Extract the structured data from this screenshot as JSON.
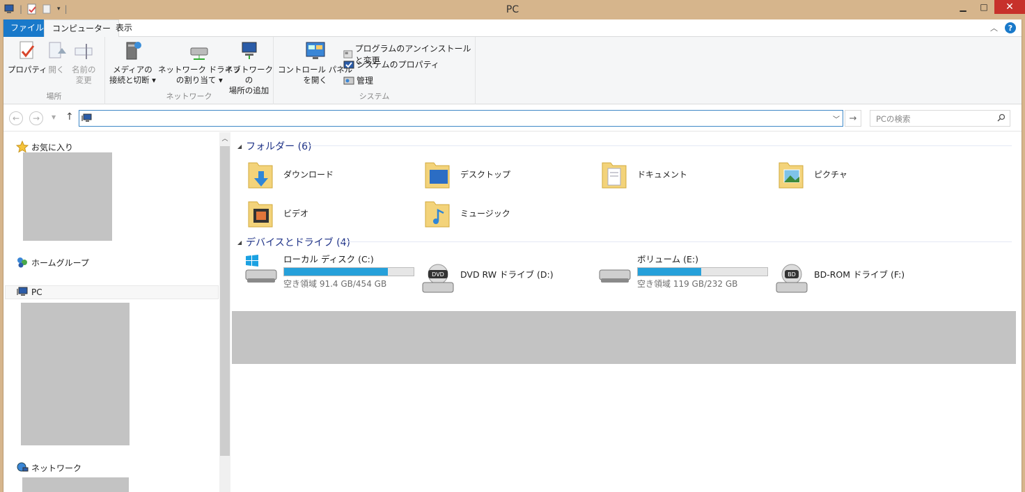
{
  "window": {
    "title": "PC"
  },
  "tabs": {
    "file": "ファイル",
    "computer": "コンピューター",
    "view": "表示"
  },
  "ribbon": {
    "location": {
      "label": "場所",
      "properties": "プロパティ",
      "open": "開く",
      "rename_l1": "名前の",
      "rename_l2": "変更"
    },
    "network": {
      "label": "ネットワーク",
      "media_l1": "メディアの",
      "media_l2": "接続と切断 ▾",
      "map_l1": "ネットワーク ドライブ",
      "map_l2": "の割り当て ▾",
      "addloc_l1": "ネットワークの",
      "addloc_l2": "場所の追加"
    },
    "system": {
      "label": "システム",
      "cp_l1": "コントロール パネル",
      "cp_l2": "を開く",
      "uninstall": "プログラムのアンインストールと変更",
      "sysprops": "システムのプロパティ",
      "manage": "管理"
    }
  },
  "address": {
    "value": "",
    "search_placeholder": "PCの検索"
  },
  "navpane": {
    "favorites": "お気に入り",
    "homegroup": "ホームグループ",
    "pc": "PC",
    "network": "ネットワーク"
  },
  "folders": {
    "header": "フォルダー (6)",
    "items": [
      "ダウンロード",
      "デスクトップ",
      "ドキュメント",
      "ピクチャ",
      "ビデオ",
      "ミュージック"
    ]
  },
  "drives": {
    "header": "デバイスとドライブ (4)",
    "items": [
      {
        "name": "ローカル ディスク (C:)",
        "free": "空き領域 91.4 GB/454 GB",
        "used_fraction": 0.8
      },
      {
        "name": "DVD RW ドライブ (D:)"
      },
      {
        "name": "ボリューム (E:)",
        "free": "空き領域 119 GB/232 GB",
        "used_fraction": 0.49
      },
      {
        "name": "BD-ROM ドライブ (F:)"
      }
    ]
  },
  "colors": {
    "accent": "#1979ca",
    "titlebar": "#d6b58c",
    "bar_fill": "#26a0da",
    "section_text": "#1e3287"
  }
}
